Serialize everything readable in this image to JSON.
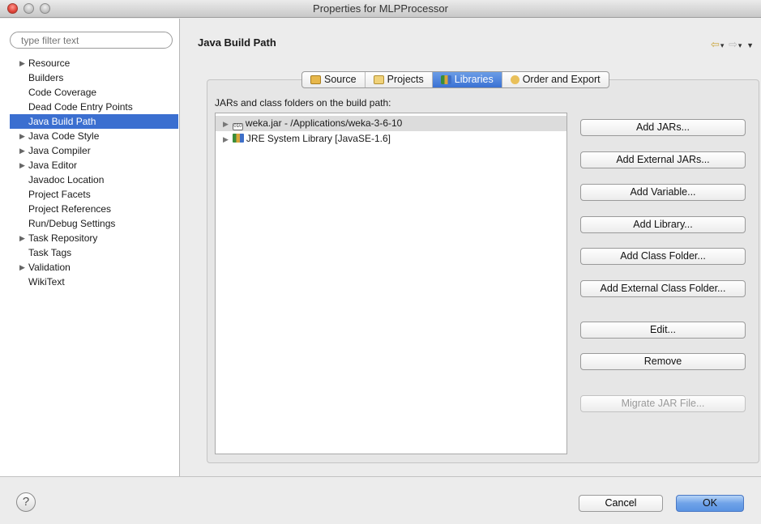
{
  "window": {
    "title": "Properties for MLPProcessor"
  },
  "sidebar": {
    "filter_placeholder": "type filter text",
    "items": [
      {
        "label": "Resource",
        "expandable": true
      },
      {
        "label": "Builders",
        "expandable": false
      },
      {
        "label": "Code Coverage",
        "expandable": false
      },
      {
        "label": "Dead Code Entry Points",
        "expandable": false
      },
      {
        "label": "Java Build Path",
        "expandable": false,
        "selected": true
      },
      {
        "label": "Java Code Style",
        "expandable": true
      },
      {
        "label": "Java Compiler",
        "expandable": true
      },
      {
        "label": "Java Editor",
        "expandable": true
      },
      {
        "label": "Javadoc Location",
        "expandable": false
      },
      {
        "label": "Project Facets",
        "expandable": false
      },
      {
        "label": "Project References",
        "expandable": false
      },
      {
        "label": "Run/Debug Settings",
        "expandable": false
      },
      {
        "label": "Task Repository",
        "expandable": true
      },
      {
        "label": "Task Tags",
        "expandable": false
      },
      {
        "label": "Validation",
        "expandable": true
      },
      {
        "label": "WikiText",
        "expandable": false
      }
    ]
  },
  "main": {
    "title": "Java Build Path",
    "tabs": [
      {
        "label": "Source",
        "icon": "source-folder-icon"
      },
      {
        "label": "Projects",
        "icon": "projects-folder-icon"
      },
      {
        "label": "Libraries",
        "icon": "libraries-icon",
        "active": true
      },
      {
        "label": "Order and Export",
        "icon": "order-export-icon"
      }
    ],
    "list_label": "JARs and class folders on the build path:",
    "entries": [
      {
        "label": "weka.jar - /Applications/weka-3-6-10",
        "icon": "jar-icon",
        "selected": true
      },
      {
        "label": "JRE System Library [JavaSE-1.6]",
        "icon": "library-icon"
      }
    ],
    "buttons": {
      "add_jars": "Add JARs...",
      "add_external_jars": "Add External JARs...",
      "add_variable": "Add Variable...",
      "add_library": "Add Library...",
      "add_class_folder": "Add Class Folder...",
      "add_external_class_folder": "Add External Class Folder...",
      "edit": "Edit...",
      "remove": "Remove",
      "migrate_jar": "Migrate JAR File..."
    }
  },
  "footer": {
    "help_glyph": "?",
    "cancel": "Cancel",
    "ok": "OK"
  },
  "colors": {
    "selection": "#3b6fd0",
    "active_tab": "#3a71d4",
    "ok_button": "#6fa2e8"
  }
}
